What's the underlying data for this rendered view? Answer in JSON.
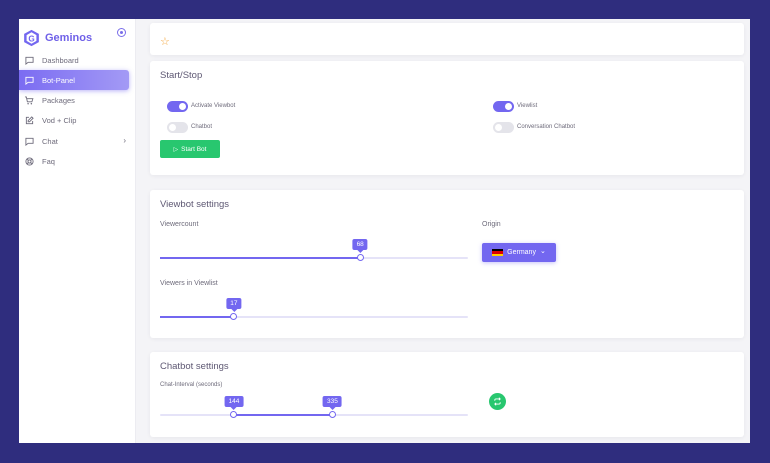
{
  "brand": {
    "name": "Geminos",
    "logo_letter": "G"
  },
  "sidebar": {
    "items": [
      {
        "label": "Dashboard",
        "icon": "message-square-icon"
      },
      {
        "label": "Bot-Panel",
        "icon": "message-square-icon",
        "active": true
      },
      {
        "label": "Packages",
        "icon": "shopping-cart-icon"
      },
      {
        "label": "Vod + Clip",
        "icon": "edit-icon"
      },
      {
        "label": "Chat",
        "icon": "message-square-icon",
        "chevron": "›"
      },
      {
        "label": "Faq",
        "icon": "life-buoy-icon"
      }
    ]
  },
  "topbar": {
    "icon": "star-icon",
    "glyph": "☆"
  },
  "start_stop": {
    "title": "Start/Stop",
    "toggles": [
      {
        "label": "Activate Viewbot",
        "on": true
      },
      {
        "label": "Viewlist",
        "on": true
      },
      {
        "label": "Chatbot",
        "on": false
      },
      {
        "label": "Conversation Chatbot",
        "on": false
      }
    ],
    "start_button": "Start Bot",
    "start_glyph": "▷"
  },
  "viewbot": {
    "title": "Viewbot settings",
    "viewercount_label": "Viewercount",
    "viewercount_value": "68",
    "viewercount_fraction": 0.65,
    "origin_label": "Origin",
    "origin_value": "Germany",
    "origin_chevron": "⌄",
    "viewlist_label": "Viewers in Viewlist",
    "viewlist_value": "17",
    "viewlist_fraction": 0.24
  },
  "chatbot": {
    "title": "Chatbot settings",
    "interval_label": "Chat-Interval (seconds)",
    "range_low": "144",
    "range_high": "335",
    "low_fraction": 0.24,
    "high_fraction": 0.56,
    "swap_icon": "repeat-icon"
  },
  "colors": {
    "accent": "#7367f0",
    "success": "#28c76f",
    "background": "#2f2d7e",
    "star": "#f3a63d"
  }
}
